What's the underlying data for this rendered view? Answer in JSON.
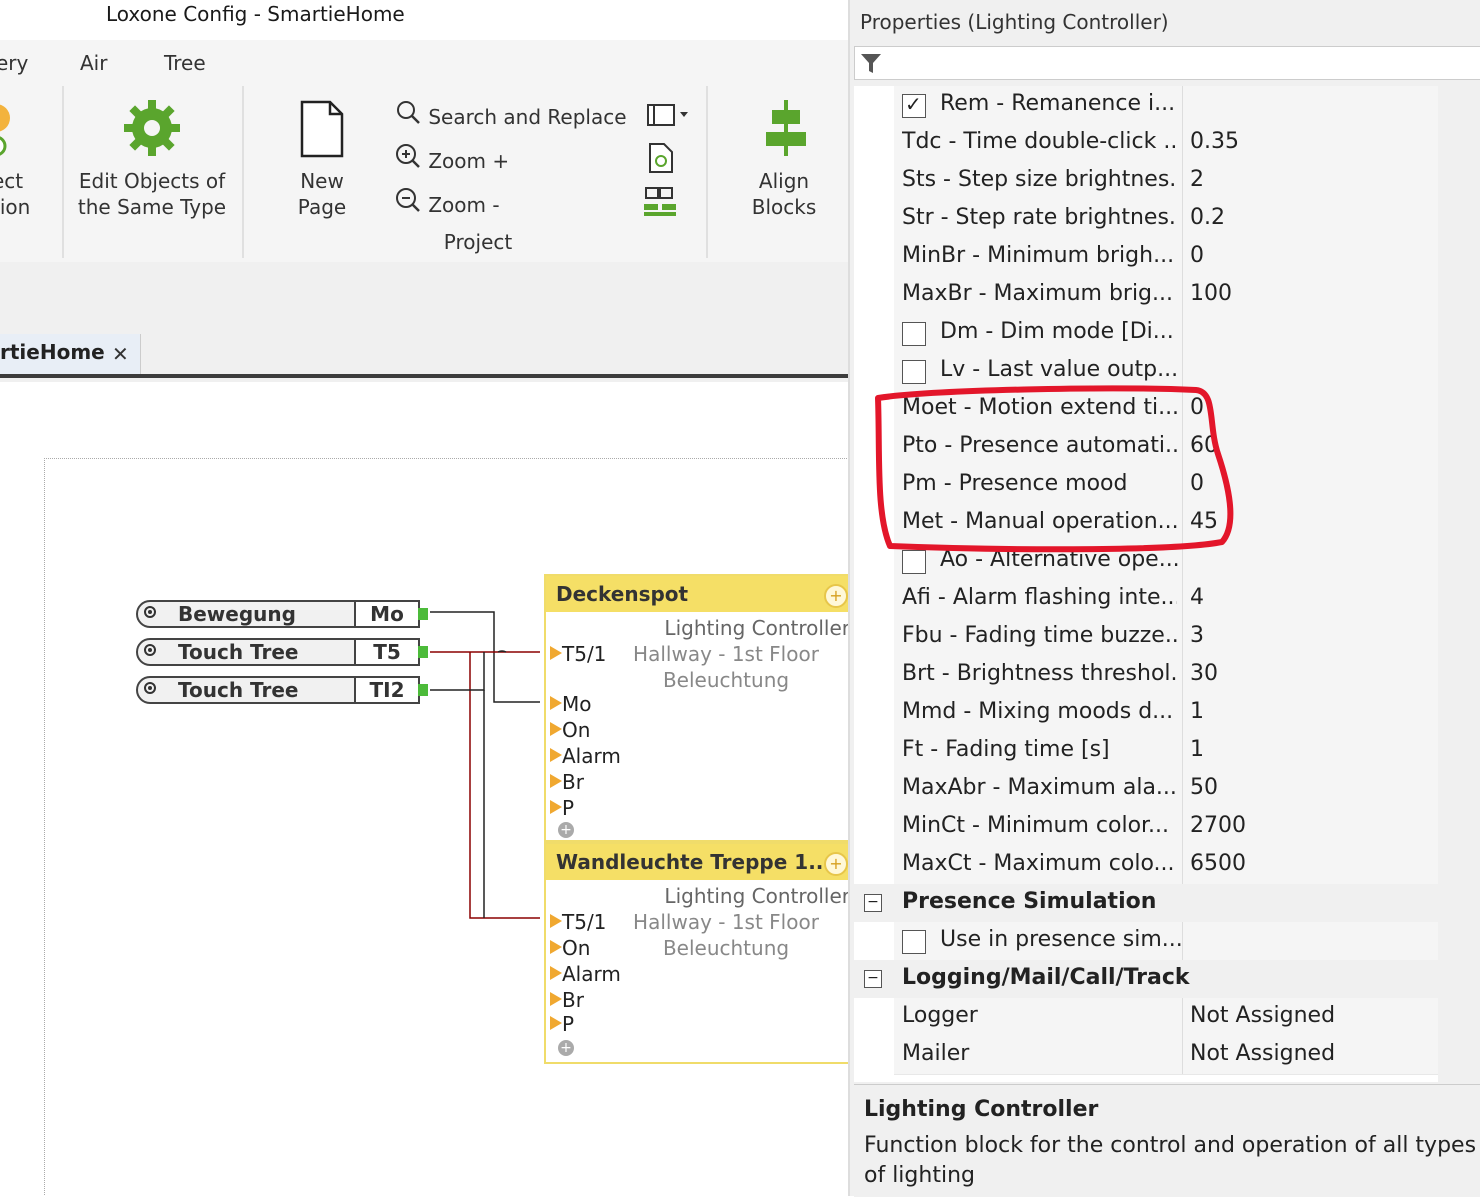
{
  "app": {
    "title": "Loxone Config - SmartieHome"
  },
  "menu": [
    "ery",
    "Air",
    "Tree"
  ],
  "ribbon": {
    "left_partial": {
      "line1": "ect",
      "line2": "tion"
    },
    "edit_objects": {
      "line1": "Edit Objects of",
      "line2": "the Same Type"
    },
    "new_page": {
      "line1": "New",
      "line2": "Page"
    },
    "search_replace": "Search and Replace",
    "zoom_in": "Zoom +",
    "zoom_out": "Zoom -",
    "project_group": "Project",
    "align_blocks": {
      "line1": "Align",
      "line2": "Blocks"
    },
    "accent": "#5aa52d"
  },
  "tabs": {
    "doc_tab": "rtieHome",
    "close": "✕"
  },
  "inputs": [
    {
      "name": "Bewegung",
      "port": "Mo"
    },
    {
      "name": "Touch Tree",
      "port": "T5"
    },
    {
      "name": "Touch Tree",
      "port": "TI2"
    }
  ],
  "blocks": [
    {
      "title": "Deckenspot",
      "type": "Lighting Controller",
      "location1": "Hallway - 1st Floor",
      "location2": "Beleuchtung",
      "inputs": [
        "T5/1",
        "Mo",
        "On",
        "Alarm",
        "Br",
        "P"
      ]
    },
    {
      "title": "Wandleuchte Treppe 1...",
      "type": "Lighting Controller",
      "location1": "Hallway - 1st Floor",
      "location2": "Beleuchtung",
      "inputs": [
        "T5/1",
        "On",
        "Alarm",
        "Br",
        "P"
      ]
    }
  ],
  "properties": {
    "title": "Properties (Lighting Controller)",
    "rows": [
      {
        "key": "Rem - Remanence i...",
        "value": "",
        "checkbox": "checked"
      },
      {
        "key": "Tdc - Time double-click ...",
        "value": "0.35"
      },
      {
        "key": "Sts - Step size brightnes...",
        "value": "2"
      },
      {
        "key": "Str - Step rate brightnes...",
        "value": "0.2"
      },
      {
        "key": "MinBr - Minimum brigh...",
        "value": "0"
      },
      {
        "key": "MaxBr - Maximum brig...",
        "value": "100"
      },
      {
        "key": "Dm - Dim mode [Di...",
        "value": "",
        "checkbox": "unchecked"
      },
      {
        "key": "Lv - Last value outp...",
        "value": "",
        "checkbox": "unchecked"
      },
      {
        "key": "Moet - Motion extend ti...",
        "value": "0"
      },
      {
        "key": "Pto - Presence automati...",
        "value": "60"
      },
      {
        "key": "Pm - Presence mood",
        "value": "0"
      },
      {
        "key": "Met - Manual operation...",
        "value": "45"
      },
      {
        "key": "Ao - Alternative ope...",
        "value": "",
        "checkbox": "unchecked"
      },
      {
        "key": "Afi - Alarm flashing inte...",
        "value": "4"
      },
      {
        "key": "Fbu - Fading time buzze...",
        "value": "3"
      },
      {
        "key": "Brt - Brightness threshol...",
        "value": "30"
      },
      {
        "key": "Mmd - Mixing moods d...",
        "value": "1"
      },
      {
        "key": "Ft - Fading time [s]",
        "value": "1"
      },
      {
        "key": "MaxAbr - Maximum ala...",
        "value": "50"
      },
      {
        "key": "MinCt - Minimum color...",
        "value": "2700"
      },
      {
        "key": "MaxCt - Maximum colo...",
        "value": "6500"
      }
    ],
    "cat_presence": "Presence Simulation",
    "presence_row": "Use in presence sim...",
    "cat_logging": "Logging/Mail/Call/Track",
    "logging_rows": [
      {
        "key": "Logger",
        "value": "Not Assigned"
      },
      {
        "key": "Mailer",
        "value": "Not Assigned"
      }
    ],
    "collapse_icon": "⊟"
  },
  "description": {
    "title": "Lighting Controller",
    "body": "Function block for the control and operation of all types of lighting"
  },
  "colors": {
    "highlight": "#e3162a",
    "block_header": "#f5df66",
    "connector_input": "#4cbb3a",
    "port_tab": "#f0a830"
  }
}
